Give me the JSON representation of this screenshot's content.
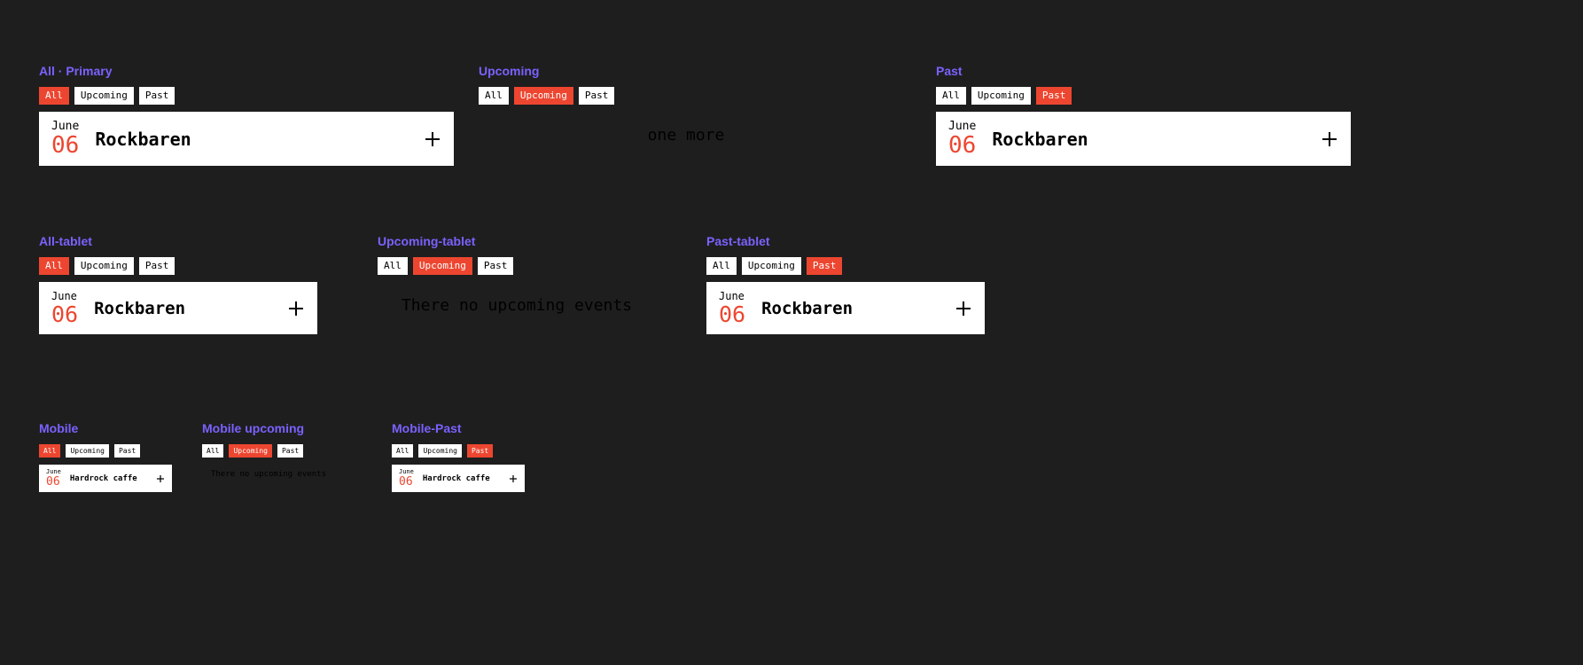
{
  "tabs": {
    "all": "All",
    "upcoming": "Upcoming",
    "past": "Past"
  },
  "frames": {
    "all_primary": {
      "title": "All · Primary"
    },
    "upcoming": {
      "title": "Upcoming",
      "empty": "one more"
    },
    "past": {
      "title": "Past"
    },
    "all_tablet": {
      "title": "All-tablet"
    },
    "upcoming_tablet": {
      "title": "Upcoming-tablet",
      "empty": "There no upcoming events"
    },
    "past_tablet": {
      "title": "Past-tablet"
    },
    "mobile": {
      "title": "Mobile"
    },
    "mobile_upcoming": {
      "title": "Mobile upcoming",
      "empty": "There no upcoming events"
    },
    "mobile_past": {
      "title": "Mobile-Past"
    }
  },
  "event_desktop": {
    "month": "June",
    "day": "06",
    "name": "Rockbaren"
  },
  "event_mobile": {
    "month": "June",
    "day": "06",
    "name": "Hardrock caffe"
  }
}
